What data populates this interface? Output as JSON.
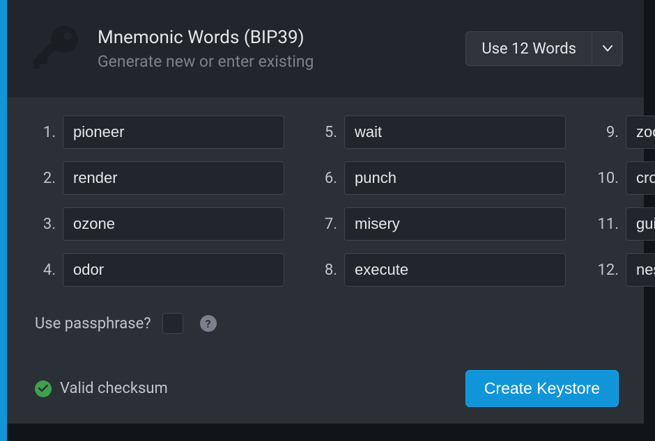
{
  "header": {
    "title": "Mnemonic Words (BIP39)",
    "subtitle": "Generate new or enter existing",
    "selector_label": "Use 12 Words"
  },
  "words": [
    "pioneer",
    "render",
    "ozone",
    "odor",
    "wait",
    "punch",
    "misery",
    "execute",
    "zoo",
    "crop",
    "guide",
    "nest"
  ],
  "passphrase": {
    "label": "Use passphrase?",
    "checked": false
  },
  "status": {
    "text": "Valid checksum"
  },
  "actions": {
    "create_label": "Create Keystore"
  },
  "colors": {
    "accent": "#1295d8",
    "success": "#3fa14d"
  }
}
